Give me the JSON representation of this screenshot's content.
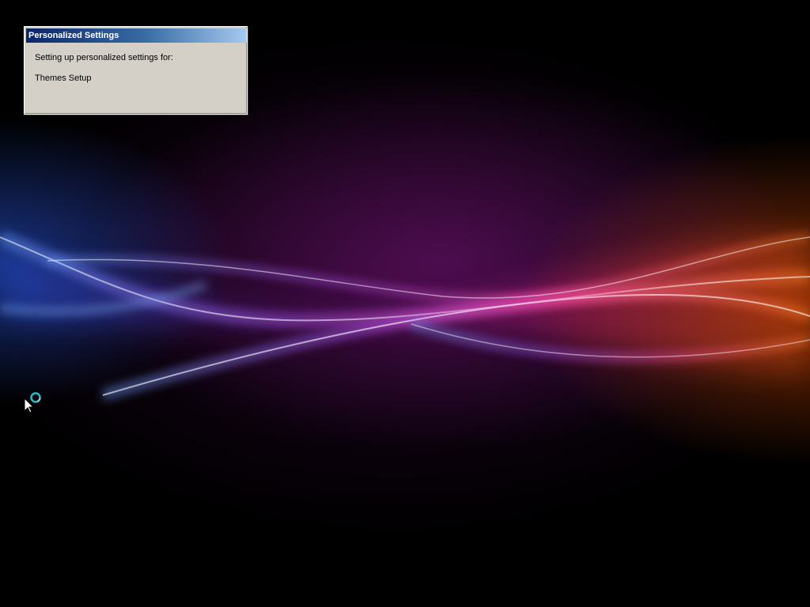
{
  "dialog": {
    "title": "Personalized Settings",
    "line1": "Setting up personalized settings for:",
    "line2": "Themes Setup"
  },
  "cursor": {
    "icon": "busy-pointer-icon"
  },
  "colors": {
    "titlebar_start": "#0a246a",
    "titlebar_end": "#a6caf0",
    "dialog_face": "#d4d0c8",
    "wave_blue": "#4a7dff",
    "wave_purple": "#b040ff",
    "wave_magenta": "#ff3fa0",
    "wave_orange": "#ff6a1a"
  }
}
